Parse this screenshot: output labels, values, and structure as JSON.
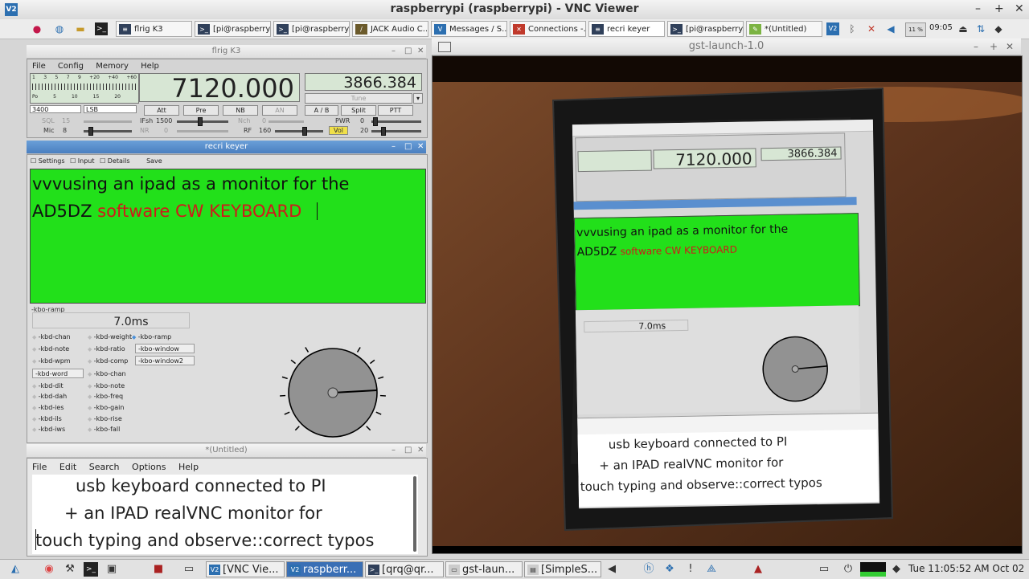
{
  "vnc": {
    "title": "raspberrypi (raspberrypi) - VNC Viewer",
    "minimize": "–",
    "maximize": "+",
    "close": "✕"
  },
  "pi_taskbar": {
    "items": [
      "flrig K3",
      "[pi@raspberry...",
      "[pi@raspberry...",
      "JACK Audio C...",
      "Messages / S...",
      "Connections -...",
      "recri keyer",
      "[pi@raspberry...",
      "*(Untitled)"
    ],
    "cpu_label": "11 %",
    "time": "09:05"
  },
  "flrig": {
    "title": "flrig K3",
    "menu": [
      "File",
      "Config",
      "Memory",
      "Help"
    ],
    "s_scale": [
      "1",
      "3",
      "5",
      "7",
      "9",
      "+20",
      "+40",
      "+60"
    ],
    "p_scale": [
      "Po",
      "5",
      "10",
      "15",
      "20"
    ],
    "freq_a": "7120.000",
    "freq_b": "3866.384",
    "tune_label": "Tune",
    "bw": "3400",
    "mode": "LSB",
    "buttons": [
      "Att",
      "Pre",
      "NB",
      "AN",
      "A / B",
      "Split",
      "PTT"
    ],
    "sql_label": "SQL",
    "sql_val": "15",
    "ifsh_label": "IFsh",
    "ifsh_val": "1500",
    "nch_label": "Nch",
    "nch_val": "0",
    "pwr_label": "PWR",
    "pwr_val": "0",
    "mic_label": "Mic",
    "mic_val": "8",
    "nr_label": "NR",
    "nr_val": "0",
    "rf_label": "RF",
    "rf_val": "160",
    "vol_label": "Vol",
    "vol_val": "20"
  },
  "keyer": {
    "title": "recri keyer",
    "tabs": [
      "Settings",
      "Input",
      "Details"
    ],
    "save": "Save",
    "line1": "vvvusing an ipad  as a monitor for the",
    "line2_prefix": "AD5DZ ",
    "line2_red": "software CW KEYBOARD",
    "ramp_label": "-kbo-ramp",
    "ramp_value": "7.0ms",
    "col1": [
      "-kbd-chan",
      "-kbd-note",
      "-kbd-wpm",
      "-kbd-word",
      "-kbd-dit",
      "-kbd-dah",
      "-kbd-ies",
      "-kbd-ils",
      "-kbd-iws"
    ],
    "col2": [
      "-kbd-weight",
      "-kbd-ratio",
      "-kbd-comp",
      "-kbo-chan",
      "-kbo-note",
      "-kbo-freq",
      "-kbo-gain",
      "-kbo-rise",
      "-kbo-fall"
    ],
    "col3_sel": "-kbo-ramp",
    "dd1": "-kbo-window",
    "dd2": "-kbo-window2"
  },
  "gedit": {
    "title": "*(Untitled)",
    "menu": [
      "File",
      "Edit",
      "Search",
      "Options",
      "Help"
    ],
    "lines": [
      "usb keyboard connected to PI",
      "+ an IPAD realVNC monitor for",
      "touch typing and observe::correct typos"
    ]
  },
  "gst": {
    "title": "gst-launch-1.0"
  },
  "ipad": {
    "freq_a": "7120.000",
    "freq_b": "3866.384",
    "line1": "vvvusing an ipad  as a monitor for the",
    "line2_prefix": "AD5DZ ",
    "line2_red": "software CW KEYBOARD",
    "ramp": "7.0ms",
    "gedit_lines": [
      "usb keyboard connected to PI",
      "+ an IPAD realVNC monitor for",
      "touch typing and observe::correct typos"
    ]
  },
  "bottom_taskbar": {
    "items": [
      "[VNC Vie...",
      "raspberr...",
      "[qrq@qr...",
      "gst-laun...",
      "[SimpleS..."
    ],
    "clock": "Tue 11:05:52 AM Oct 02"
  }
}
